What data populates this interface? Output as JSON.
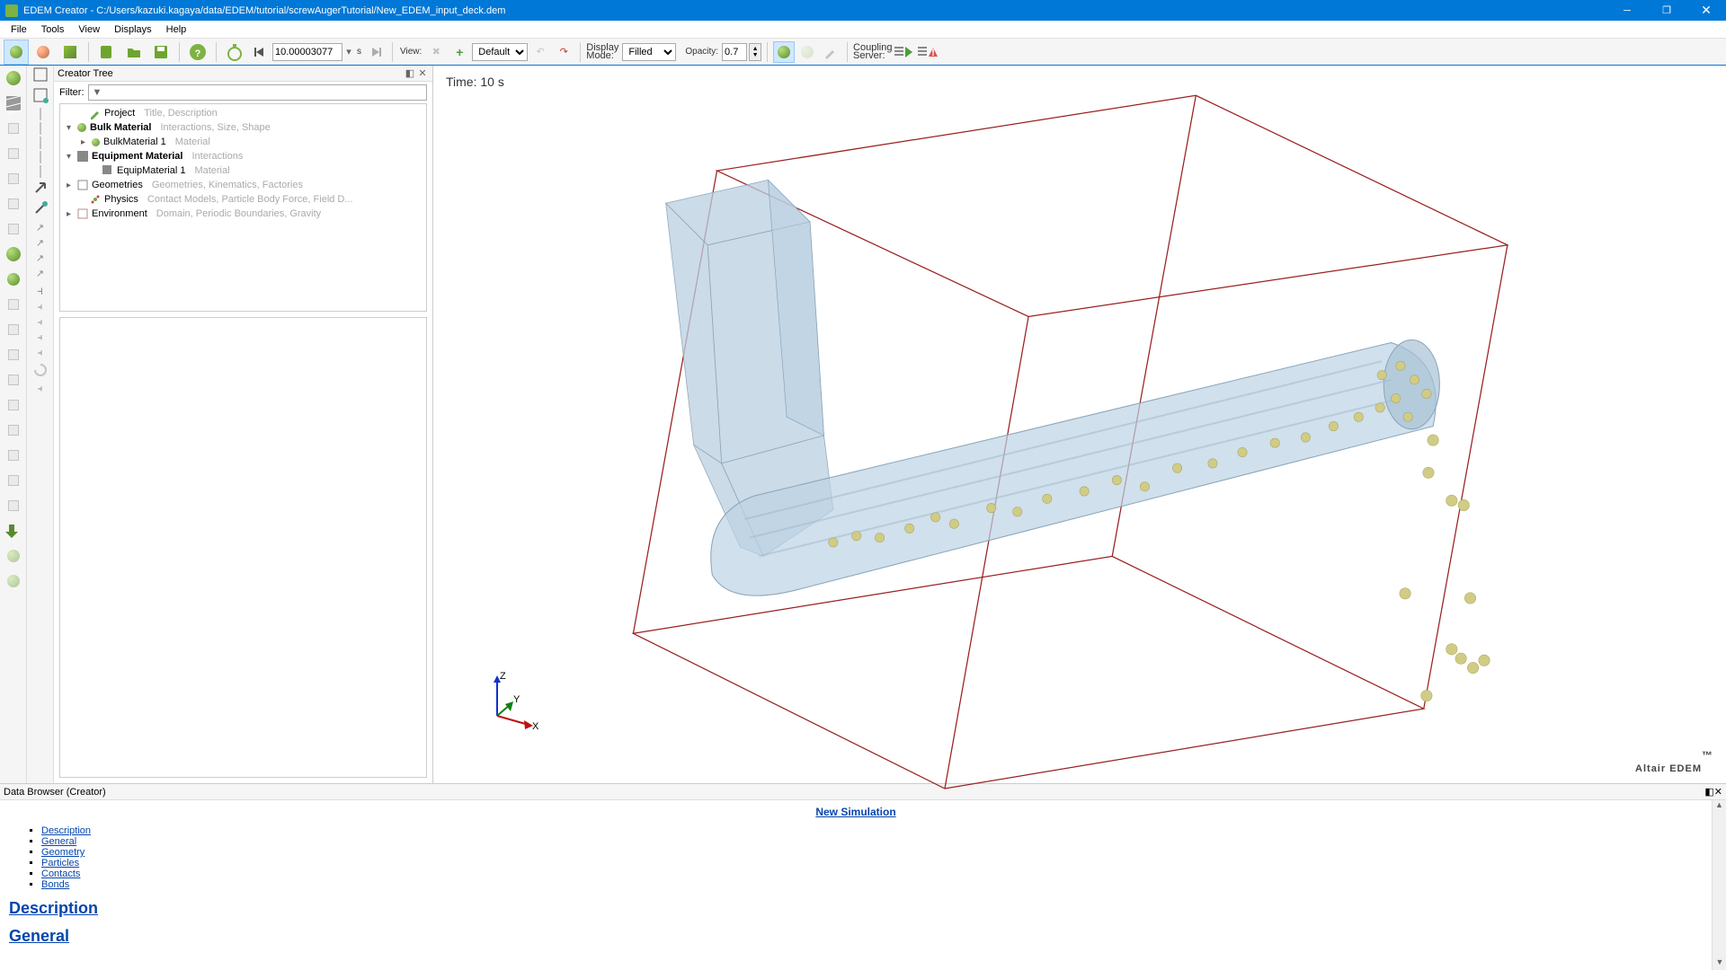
{
  "window": {
    "title": "EDEM Creator - C:/Users/kazuki.kagaya/data/EDEM/tutorial/screwAugerTutorial/New_EDEM_input_deck.dem"
  },
  "menu": [
    "File",
    "Tools",
    "View",
    "Displays",
    "Help"
  ],
  "toolbar": {
    "time_value": "10.00003077",
    "time_unit": "s",
    "view_label": "View:",
    "view_default": "Default",
    "display_mode_label1": "Display",
    "display_mode_label2": "Mode:",
    "display_mode_value": "Filled",
    "opacity_label": "Opacity:",
    "opacity_value": "0.7",
    "coupling_label1": "Coupling",
    "coupling_label2": "Server:"
  },
  "creator_tree": {
    "title": "Creator Tree",
    "filter_label": "Filter:",
    "items": [
      {
        "indent": 0,
        "exp": "",
        "name": "Project",
        "desc": "Title, Description",
        "icon": "pencil"
      },
      {
        "indent": 0,
        "exp": "▾",
        "name": "Bulk Material",
        "desc": "Interactions, Size, Shape",
        "icon": "sphere",
        "bold": true
      },
      {
        "indent": 1,
        "exp": "▸",
        "name": "BulkMaterial 1",
        "desc": "Material",
        "icon": "sphere-sm"
      },
      {
        "indent": 0,
        "exp": "▾",
        "name": "Equipment Material",
        "desc": "Interactions",
        "icon": "hatch",
        "bold": true
      },
      {
        "indent": 1,
        "exp": "",
        "name": "EquipMaterial 1",
        "desc": "Material",
        "icon": "hatch-sm"
      },
      {
        "indent": 0,
        "exp": "▸",
        "name": "Geometries",
        "desc": "Geometries, Kinematics, Factories",
        "icon": "box"
      },
      {
        "indent": 0,
        "exp": "",
        "name": "Physics",
        "desc": "Contact Models, Particle Body Force, Field D...",
        "icon": "physics"
      },
      {
        "indent": 0,
        "exp": "▸",
        "name": "Environment",
        "desc": "Domain, Periodic Boundaries, Gravity",
        "icon": "env"
      }
    ]
  },
  "viewport": {
    "time_text": "Time: 10 s",
    "brand": "Altair EDEM",
    "axes": {
      "x": "X",
      "y": "Y",
      "z": "Z"
    }
  },
  "data_browser": {
    "title": "Data Browser (Creator)",
    "heading": "New Simulation",
    "links": [
      "Description",
      "General",
      "Geometry",
      "Particles",
      "Contacts",
      "Bonds"
    ],
    "section1": "Description",
    "section2": "General"
  }
}
